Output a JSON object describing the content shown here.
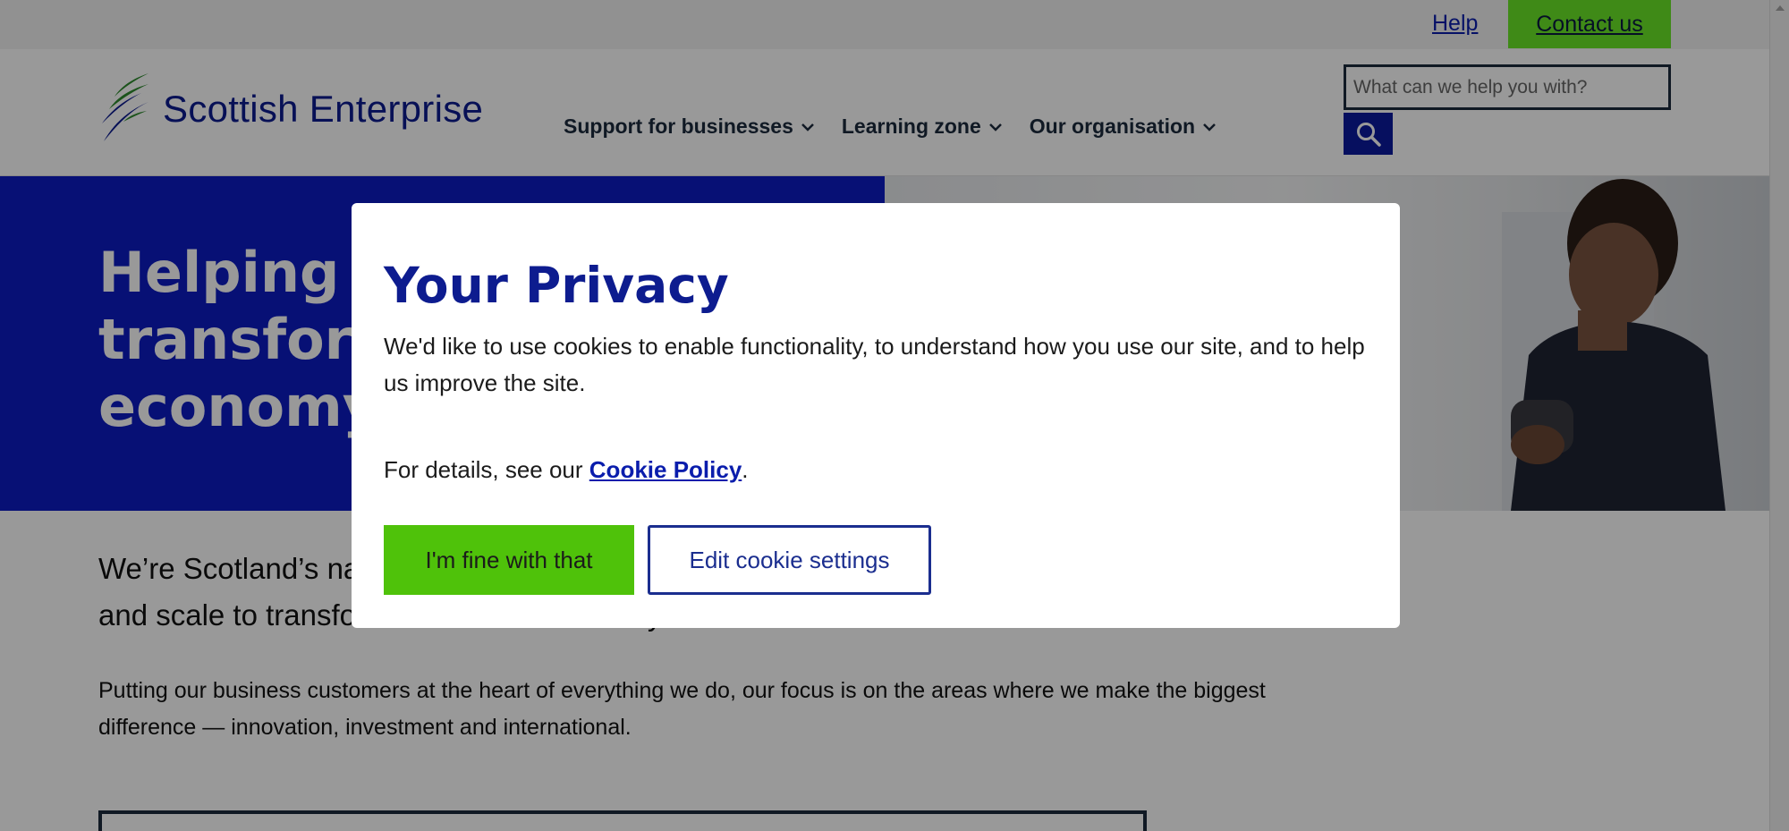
{
  "utility_bar": {
    "help_label": "Help",
    "contact_label": "Contact us"
  },
  "header": {
    "logo_text": "Scottish Enterprise",
    "nav": [
      {
        "label": "Support for businesses"
      },
      {
        "label": "Learning zone"
      },
      {
        "label": "Our organisation"
      }
    ],
    "search": {
      "placeholder": "What can we help you with?",
      "button_icon": "search-icon"
    }
  },
  "hero": {
    "title": "Helping businesses transform Scotland's economy"
  },
  "main": {
    "intro": "We’re Scotland’s national economic development agency. We help businesses innovate and scale to transform Scotland’s economy.",
    "body": "Putting our business customers at the heart of everything we do, our focus is on the areas where we make the biggest difference — innovation, investment and international."
  },
  "cookie_modal": {
    "title": "Your Privacy",
    "text": "We'd like to use cookies to enable functionality, to understand how you use our site, and to help us improve the site.",
    "details_prefix": "For details, see our ",
    "policy_link": "Cookie Policy",
    "details_suffix": ".",
    "accept_label": "I'm fine with that",
    "settings_label": "Edit cookie settings"
  },
  "colors": {
    "brand_blue": "#0c1cc4",
    "accent_green": "#4fc20a",
    "contact_green": "#6ae627",
    "link_blue": "#0a1dac"
  }
}
